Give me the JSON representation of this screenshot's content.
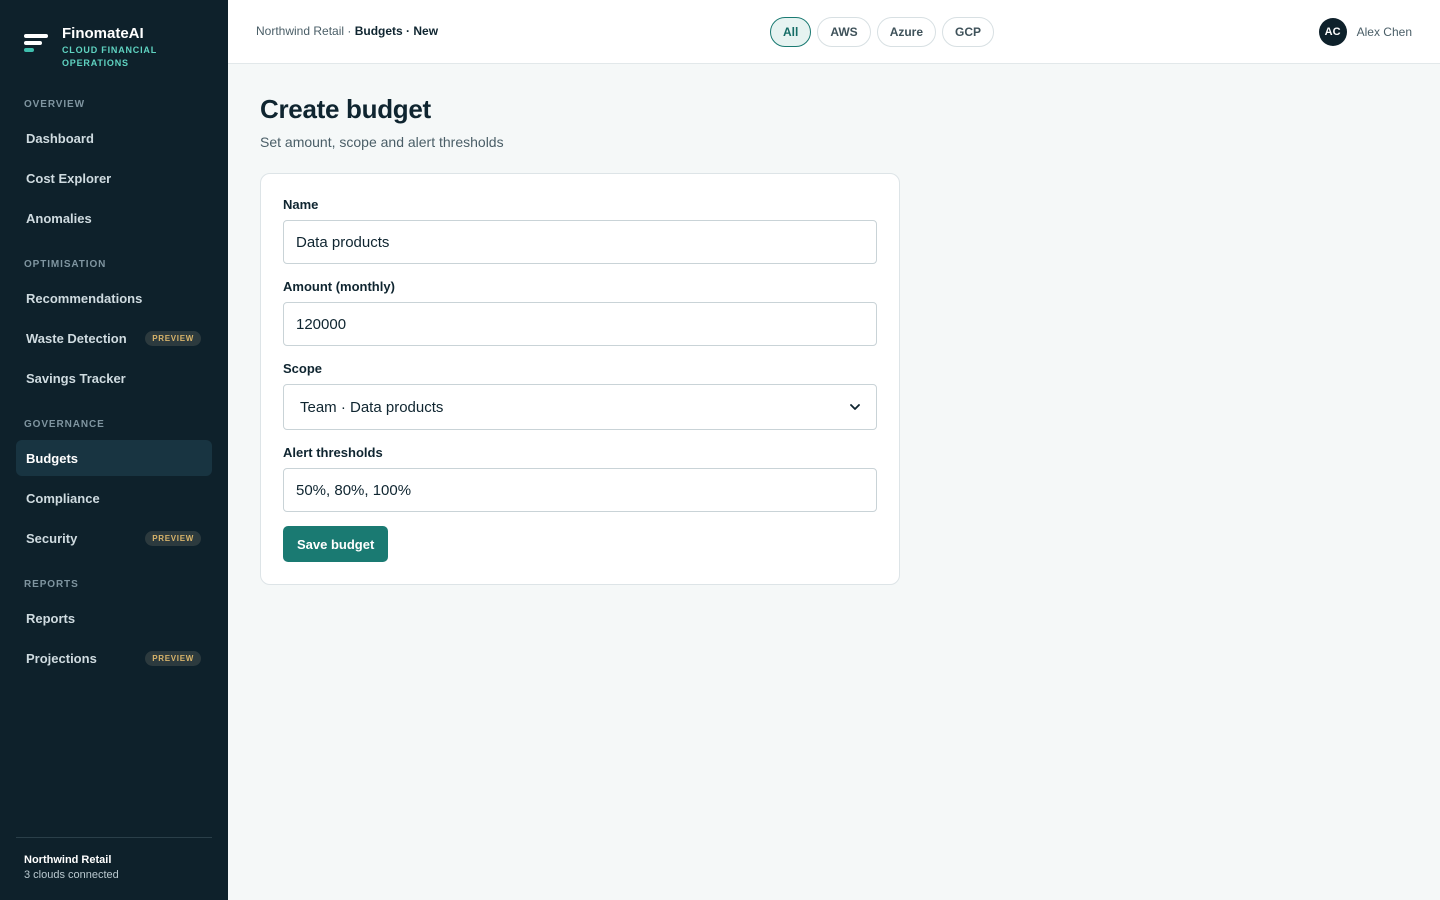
{
  "brand": {
    "name": "FinomateAI",
    "tagline": "CLOUD FINANCIAL OPERATIONS"
  },
  "sidebar": {
    "sections": [
      {
        "title": "OVERVIEW",
        "items": [
          {
            "label": "Dashboard"
          },
          {
            "label": "Cost Explorer"
          },
          {
            "label": "Anomalies"
          }
        ]
      },
      {
        "title": "OPTIMISATION",
        "items": [
          {
            "label": "Recommendations"
          },
          {
            "label": "Waste Detection",
            "badge": "PREVIEW"
          },
          {
            "label": "Savings Tracker"
          }
        ]
      },
      {
        "title": "GOVERNANCE",
        "items": [
          {
            "label": "Budgets",
            "active": true
          },
          {
            "label": "Compliance"
          },
          {
            "label": "Security",
            "badge": "PREVIEW"
          }
        ]
      },
      {
        "title": "REPORTS",
        "items": [
          {
            "label": "Reports"
          },
          {
            "label": "Projections",
            "badge": "PREVIEW"
          }
        ]
      }
    ],
    "footer": {
      "org": "Northwind Retail",
      "status": "3 clouds connected"
    }
  },
  "topbar": {
    "breadcrumb": {
      "org": "Northwind Retail",
      "separator": " · ",
      "current": "Budgets · New"
    },
    "cloud_filter": {
      "options": [
        "All",
        "AWS",
        "Azure",
        "GCP"
      ],
      "selected": "All"
    },
    "user": {
      "initials": "AC",
      "name": "Alex Chen"
    }
  },
  "page": {
    "title": "Create budget",
    "subtitle": "Set amount, scope and alert thresholds"
  },
  "form": {
    "name": {
      "label": "Name",
      "value": "Data products"
    },
    "amount": {
      "label": "Amount (monthly)",
      "value": "120000"
    },
    "scope": {
      "label": "Scope",
      "value": "Team · Data products"
    },
    "thresholds": {
      "label": "Alert thresholds",
      "value": "50%, 80%, 100%"
    },
    "submit_label": "Save budget"
  },
  "icons": {
    "brand": "brand-logo-icon",
    "select": "chevron-down-icon"
  },
  "colors": {
    "sidebar_bg": "#0e212b",
    "accent": "#1a7a72",
    "accent_light": "#5fd3c1",
    "preview_badge": "#d8b46a",
    "page_bg": "#f5f8f8"
  }
}
